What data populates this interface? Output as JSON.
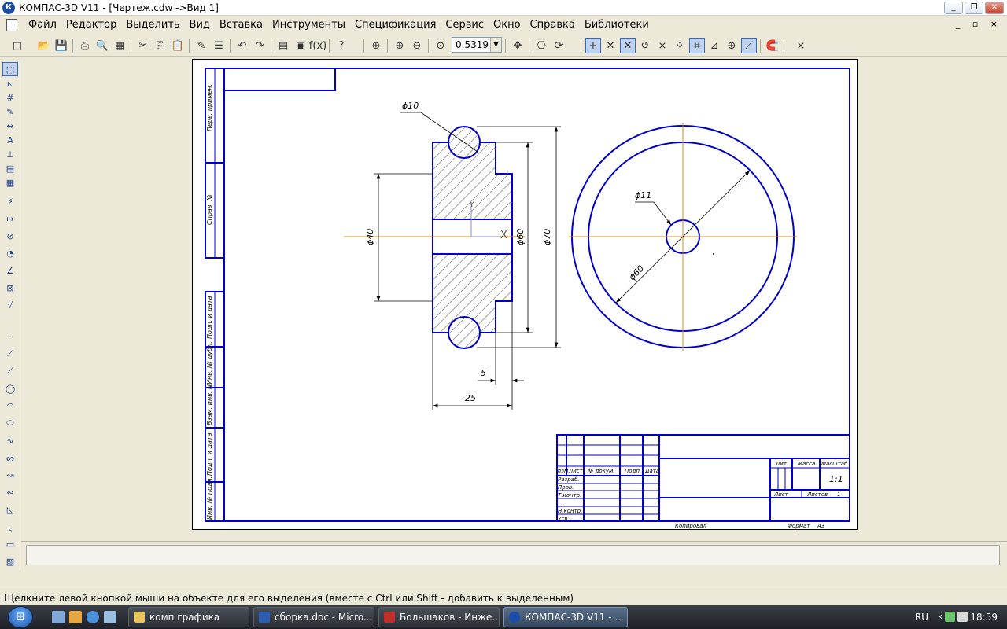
{
  "window": {
    "title": "КОМПАС-3D V11 - [Чертеж.cdw ->Вид 1]",
    "app_icon": "К",
    "buttons": [
      "_",
      "❐",
      "✕"
    ]
  },
  "menu": {
    "items": [
      "Файл",
      "Редактор",
      "Выделить",
      "Вид",
      "Вставка",
      "Инструменты",
      "Спецификация",
      "Сервис",
      "Окно",
      "Справка",
      "Библиотеки"
    ],
    "mdi_controls": "_ ▫ ×"
  },
  "toolbar": {
    "zoom_value": "0.5319"
  },
  "drawing": {
    "dim_d10": "ϕ10",
    "dim_d40": "ϕ40",
    "dim_d60_section": "ϕ60",
    "dim_d70": "ϕ70",
    "dim_5": "5",
    "dim_25": "25",
    "dim_d11": "ϕ11",
    "dim_d60_view": "ϕ60",
    "axis_x": "X",
    "axis_y": "Y",
    "frame_labels": [
      "Перв. примен.",
      "Справ. №",
      "Подп. и дата",
      "Инв. № дубл.",
      "Взам. инв. №",
      "Подп. и дата",
      "Инв. № подл."
    ],
    "stamp": {
      "header_cols": [
        "Изм",
        "Лист",
        "№ докум.",
        "Подп.",
        "Дата"
      ],
      "rows": [
        "Разраб.",
        "Пров.",
        "Т.контр.",
        "Н.контр.",
        "Утв."
      ],
      "lit": "Лит.",
      "massa": "Масса",
      "masshtab": "Масштаб",
      "scale_value": "1:1",
      "list": "Лист",
      "listov": "Листов",
      "listov_value": "1",
      "kopiroval": "Копировал",
      "format": "Формат",
      "format_value": "А3"
    }
  },
  "status": {
    "text": "Щелкните левой кнопкой мыши на объекте для его выделения (вместе с Ctrl или Shift - добавить к выделенным)"
  },
  "taskbar": {
    "start_label": "⊞",
    "tasks": [
      {
        "label": "комп графика",
        "color": "#e8c25a",
        "active": false
      },
      {
        "label": "сборка.doc - Micro...",
        "color": "#2b5fb4",
        "active": false
      },
      {
        "label": "Большаков - Инже...",
        "color": "#c0302a",
        "active": false
      },
      {
        "label": "КОМПАС-3D V11 - ...",
        "color": "#1a4ea8",
        "active": true
      }
    ],
    "lang": "RU",
    "clock": "18:59"
  },
  "colors": {
    "line_blue": "#0000c8",
    "axis_orange": "#d08c1c",
    "thin": "#000000"
  }
}
